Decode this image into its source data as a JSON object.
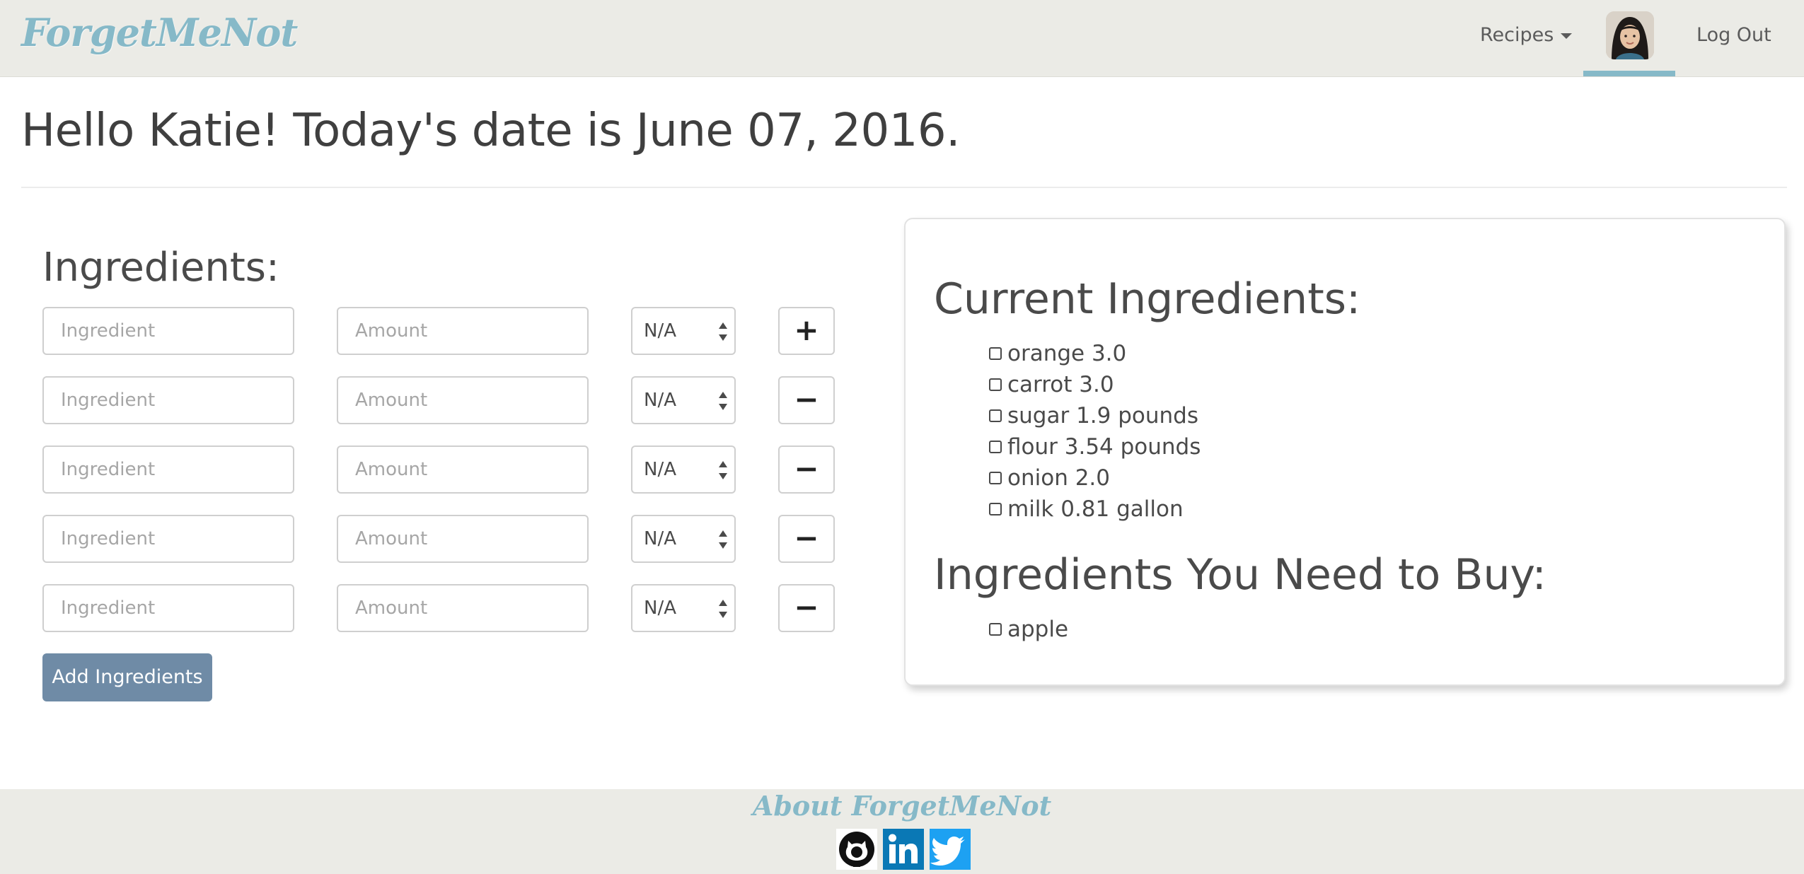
{
  "navbar": {
    "brand": "ForgetMeNot",
    "recipes_label": "Recipes",
    "logout_label": "Log Out"
  },
  "header": {
    "greeting": "Hello Katie! Today's date is June 07, 2016."
  },
  "form": {
    "title": "Ingredients:",
    "ingredient_placeholder": "Ingredient",
    "amount_placeholder": "Amount",
    "unit_value": "N/A",
    "add_row_symbol": "+",
    "remove_row_symbol": "−",
    "submit_label": "Add Ingredients"
  },
  "panel": {
    "current_title": "Current Ingredients:",
    "current_items": [
      "orange 3.0",
      "carrot 3.0",
      "sugar 1.9 pounds",
      "flour 3.54 pounds",
      "onion 2.0",
      "milk 0.81 gallon"
    ],
    "buy_title": "Ingredients You Need to Buy:",
    "buy_items": [
      "apple"
    ]
  },
  "footer": {
    "title": "About ForgetMeNot",
    "icons": [
      "github-icon",
      "linkedin-icon",
      "twitter-icon"
    ]
  },
  "colors": {
    "brand": "#86b9c8",
    "navbar_bg": "#ebebe6",
    "button_primary": "#6f8ba6"
  }
}
